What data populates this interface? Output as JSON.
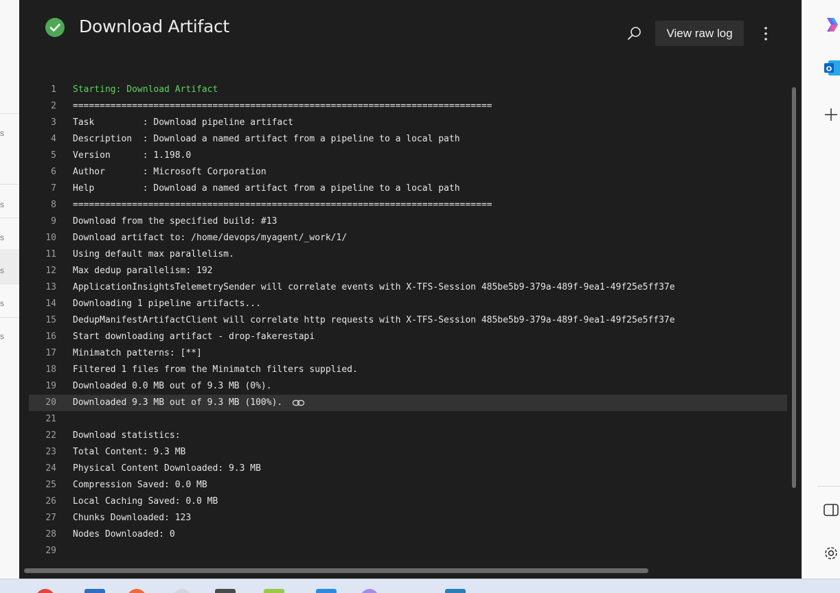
{
  "panel": {
    "title": "Download Artifact",
    "status": "succeeded",
    "view_raw_log_label": "View raw log",
    "search_icon": "search-icon",
    "more_icon": "more-vertical-icon"
  },
  "log": {
    "highlighted_line": 20,
    "lines": [
      {
        "n": "1",
        "text": "Starting: Download Artifact"
      },
      {
        "n": "2",
        "text": "=============================================================================="
      },
      {
        "n": "3",
        "text": "Task         : Download pipeline artifact"
      },
      {
        "n": "4",
        "text": "Description  : Download a named artifact from a pipeline to a local path"
      },
      {
        "n": "5",
        "text": "Version      : 1.198.0"
      },
      {
        "n": "6",
        "text": "Author       : Microsoft Corporation"
      },
      {
        "n": "7",
        "text": "Help         : Download a named artifact from a pipeline to a local path"
      },
      {
        "n": "8",
        "text": "=============================================================================="
      },
      {
        "n": "9",
        "text": "Download from the specified build: #13"
      },
      {
        "n": "10",
        "text": "Download artifact to: /home/devops/myagent/_work/1/"
      },
      {
        "n": "11",
        "text": "Using default max parallelism."
      },
      {
        "n": "12",
        "text": "Max dedup parallelism: 192"
      },
      {
        "n": "13",
        "text": "ApplicationInsightsTelemetrySender will correlate events with X-TFS-Session 485be5b9-379a-489f-9ea1-49f25e5ff37e"
      },
      {
        "n": "14",
        "text": "Downloading 1 pipeline artifacts..."
      },
      {
        "n": "15",
        "text": "DedupManifestArtifactClient will correlate http requests with X-TFS-Session 485be5b9-379a-489f-9ea1-49f25e5ff37e"
      },
      {
        "n": "16",
        "text": "Start downloading artifact - drop-fakerestapi"
      },
      {
        "n": "17",
        "text": "Minimatch patterns: [**]"
      },
      {
        "n": "18",
        "text": "Filtered 1 files from the Minimatch filters supplied."
      },
      {
        "n": "19",
        "text": "Downloaded 0.0 MB out of 9.3 MB (0%)."
      },
      {
        "n": "20",
        "text": "Downloaded 9.3 MB out of 9.3 MB (100%)."
      },
      {
        "n": "21",
        "text": ""
      },
      {
        "n": "22",
        "text": "Download statistics:"
      },
      {
        "n": "23",
        "text": "Total Content: 9.3 MB"
      },
      {
        "n": "24",
        "text": "Physical Content Downloaded: 9.3 MB"
      },
      {
        "n": "25",
        "text": "Compression Saved: 0.0 MB"
      },
      {
        "n": "26",
        "text": "Local Caching Saved: 0.0 MB"
      },
      {
        "n": "27",
        "text": "Chunks Downloaded: 123"
      },
      {
        "n": "28",
        "text": "Nodes Downloaded: 0"
      },
      {
        "n": "29",
        "text": ""
      }
    ]
  },
  "edge_sidebar": {
    "items": [
      "copilot-icon",
      "outlook-icon",
      "add-icon",
      "sidebar-toggle-icon",
      "settings-icon"
    ]
  },
  "colors": {
    "panel_bg": "#1e1e1e",
    "success": "#4ea855",
    "log_highlight": "#5fd35f",
    "text": "#e6e6e6"
  }
}
